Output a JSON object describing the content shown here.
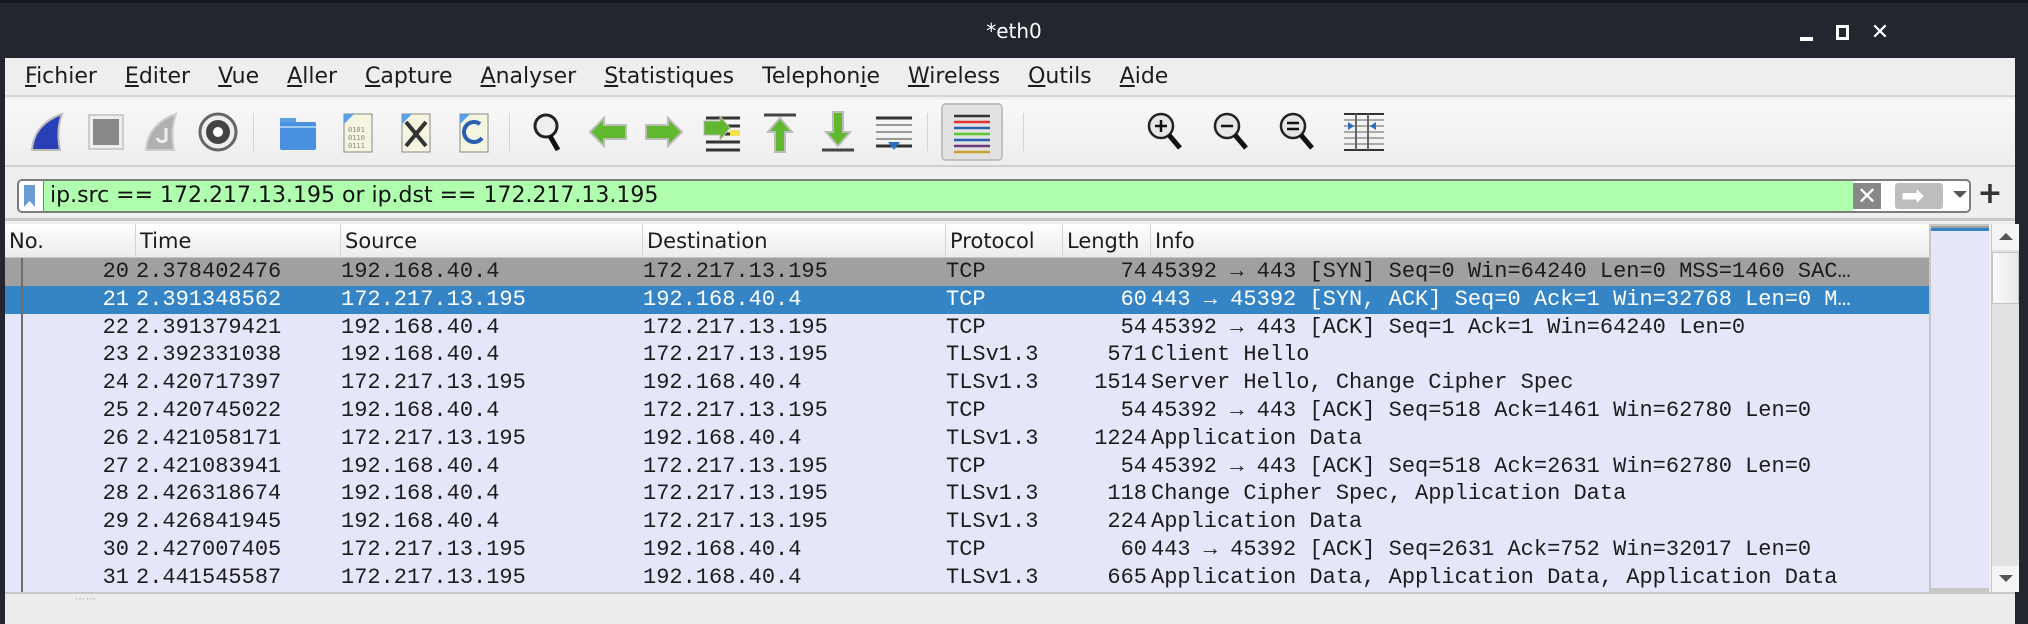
{
  "window": {
    "title": "*eth0",
    "controls": {
      "minimize": "minimize",
      "maximize": "maximize",
      "close": "✕"
    }
  },
  "menubar": {
    "items": [
      {
        "label": "Fichier",
        "accel": "F"
      },
      {
        "label": "Editer",
        "accel": "E"
      },
      {
        "label": "Vue",
        "accel": "V"
      },
      {
        "label": "Aller",
        "accel": "A"
      },
      {
        "label": "Capture",
        "accel": "C"
      },
      {
        "label": "Analyser",
        "accel": "A"
      },
      {
        "label": "Statistiques",
        "accel": "S"
      },
      {
        "label": "Telephonie",
        "accel": "i"
      },
      {
        "label": "Wireless",
        "accel": "W"
      },
      {
        "label": "Outils",
        "accel": "O"
      },
      {
        "label": "Aide",
        "accel": "A"
      }
    ]
  },
  "toolbar": {
    "buttons": [
      {
        "name": "start-capture",
        "icon": "shark-fin-blue-icon"
      },
      {
        "name": "stop-capture",
        "icon": "stop-square-icon"
      },
      {
        "name": "restart-capture",
        "icon": "shark-fin-restart-icon"
      },
      {
        "name": "capture-options",
        "icon": "gear-icon"
      },
      {
        "name": "open-file",
        "icon": "folder-icon"
      },
      {
        "name": "save-file",
        "icon": "file-binary-icon"
      },
      {
        "name": "close-file",
        "icon": "file-close-icon"
      },
      {
        "name": "reload-file",
        "icon": "file-reload-icon"
      },
      {
        "name": "find-packet",
        "icon": "magnifier-icon"
      },
      {
        "name": "go-back",
        "icon": "arrow-left-icon"
      },
      {
        "name": "go-forward",
        "icon": "arrow-right-icon"
      },
      {
        "name": "go-to-packet",
        "icon": "goto-packet-icon"
      },
      {
        "name": "go-first",
        "icon": "arrow-up-first-icon"
      },
      {
        "name": "go-last",
        "icon": "arrow-down-last-icon"
      },
      {
        "name": "autoscroll",
        "icon": "autoscroll-icon"
      },
      {
        "name": "colorize",
        "icon": "colorize-lines-icon",
        "active": true
      },
      {
        "name": "zoom-in",
        "icon": "zoom-in-icon"
      },
      {
        "name": "zoom-out",
        "icon": "zoom-out-icon"
      },
      {
        "name": "zoom-reset",
        "icon": "zoom-reset-icon"
      },
      {
        "name": "resize-columns",
        "icon": "resize-columns-icon"
      }
    ]
  },
  "filter": {
    "value": "ip.src == 172.217.13.195 or ip.dst == 172.217.13.195",
    "status_color": "#afffaf",
    "clear_label": "✕",
    "add_label": "+"
  },
  "packet_list": {
    "columns": [
      "No.",
      "Time",
      "Source",
      "Destination",
      "Protocol",
      "Length",
      "Info"
    ],
    "rows": [
      {
        "no": "20",
        "time": "2.378402476",
        "source": "192.168.40.4",
        "destination": "172.217.13.195",
        "protocol": "TCP",
        "length": "74",
        "info": "45392 → 443 [SYN] Seq=0 Win=64240 Len=0 MSS=1460 SAC…",
        "style": "syn"
      },
      {
        "no": "21",
        "time": "2.391348562",
        "source": "172.217.13.195",
        "destination": "192.168.40.4",
        "protocol": "TCP",
        "length": "60",
        "info": "443 → 45392 [SYN, ACK] Seq=0 Ack=1 Win=32768 Len=0 M…",
        "style": "selected"
      },
      {
        "no": "22",
        "time": "2.391379421",
        "source": "192.168.40.4",
        "destination": "172.217.13.195",
        "protocol": "TCP",
        "length": "54",
        "info": "45392 → 443 [ACK] Seq=1 Ack=1 Win=64240 Len=0",
        "style": "normal"
      },
      {
        "no": "23",
        "time": "2.392331038",
        "source": "192.168.40.4",
        "destination": "172.217.13.195",
        "protocol": "TLSv1.3",
        "length": "571",
        "info": "Client Hello",
        "style": "normal"
      },
      {
        "no": "24",
        "time": "2.420717397",
        "source": "172.217.13.195",
        "destination": "192.168.40.4",
        "protocol": "TLSv1.3",
        "length": "1514",
        "info": "Server Hello, Change Cipher Spec",
        "style": "normal"
      },
      {
        "no": "25",
        "time": "2.420745022",
        "source": "192.168.40.4",
        "destination": "172.217.13.195",
        "protocol": "TCP",
        "length": "54",
        "info": "45392 → 443 [ACK] Seq=518 Ack=1461 Win=62780 Len=0",
        "style": "normal"
      },
      {
        "no": "26",
        "time": "2.421058171",
        "source": "172.217.13.195",
        "destination": "192.168.40.4",
        "protocol": "TLSv1.3",
        "length": "1224",
        "info": "Application Data",
        "style": "normal"
      },
      {
        "no": "27",
        "time": "2.421083941",
        "source": "192.168.40.4",
        "destination": "172.217.13.195",
        "protocol": "TCP",
        "length": "54",
        "info": "45392 → 443 [ACK] Seq=518 Ack=2631 Win=62780 Len=0",
        "style": "normal"
      },
      {
        "no": "28",
        "time": "2.426318674",
        "source": "192.168.40.4",
        "destination": "172.217.13.195",
        "protocol": "TLSv1.3",
        "length": "118",
        "info": "Change Cipher Spec, Application Data",
        "style": "normal"
      },
      {
        "no": "29",
        "time": "2.426841945",
        "source": "192.168.40.4",
        "destination": "172.217.13.195",
        "protocol": "TLSv1.3",
        "length": "224",
        "info": "Application Data",
        "style": "normal"
      },
      {
        "no": "30",
        "time": "2.427007405",
        "source": "172.217.13.195",
        "destination": "192.168.40.4",
        "protocol": "TCP",
        "length": "60",
        "info": "443 → 45392 [ACK] Seq=2631 Ack=752 Win=32017 Len=0",
        "style": "normal"
      },
      {
        "no": "31",
        "time": "2.441545587",
        "source": "172.217.13.195",
        "destination": "192.168.40.4",
        "protocol": "TLSv1.3",
        "length": "665",
        "info": "Application Data, Application Data, Application Data",
        "style": "normal"
      }
    ]
  },
  "colors": {
    "row_normal": "#e6e6fa",
    "row_syn": "#a0a0a0",
    "row_selected": "#3584c6",
    "filter_valid": "#afffaf"
  }
}
